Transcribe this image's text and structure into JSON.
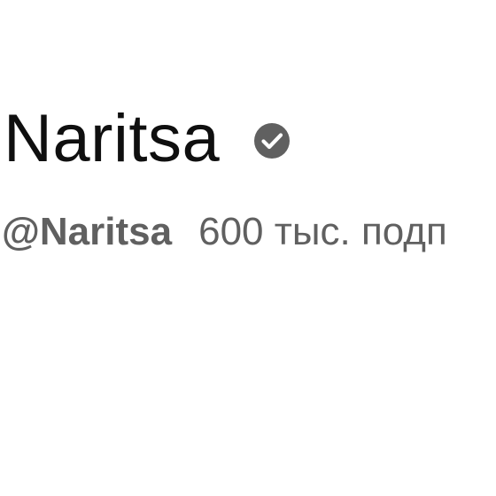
{
  "channel": {
    "name": "Naritsa",
    "verified_icon": "verified-check-icon",
    "handle": "@Naritsa",
    "subscribers": "600 тыс. подп"
  },
  "colors": {
    "name_text": "#0f0f0f",
    "meta_text": "#606060",
    "badge": "#606060"
  }
}
